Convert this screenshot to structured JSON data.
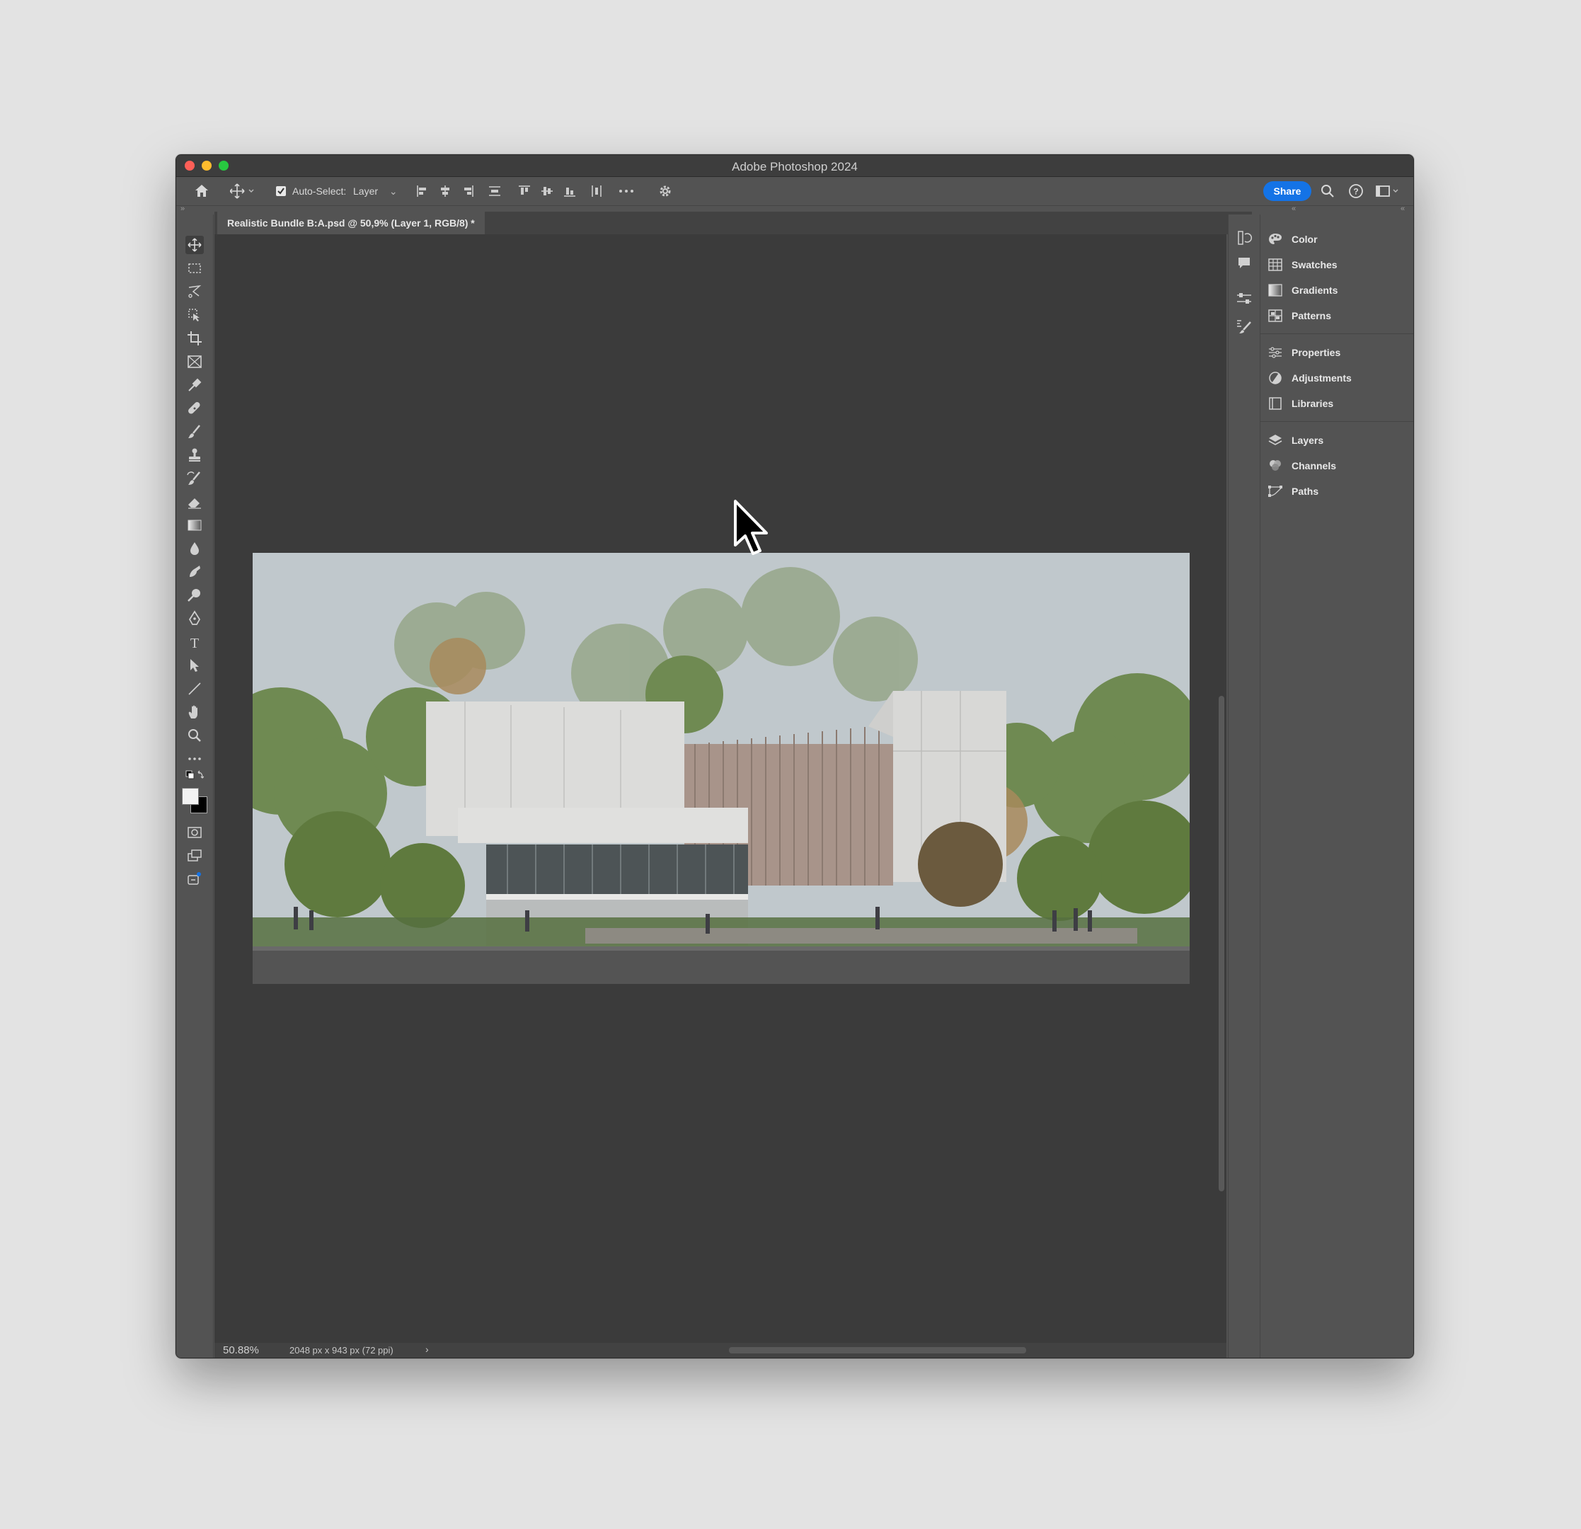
{
  "window": {
    "title": "Adobe Photoshop 2024"
  },
  "options_bar": {
    "auto_select_label": "Auto-Select:",
    "auto_select_checked": true,
    "auto_select_target": "Layer",
    "share_label": "Share"
  },
  "document": {
    "tab_title": "Realistic Bundle B:A.psd @ 50,9% (Layer 1, RGB/8) *"
  },
  "status": {
    "zoom": "50.88%",
    "doc_info": "2048 px x 943 px (72 ppi)"
  },
  "toolbar": {
    "tools": [
      "move-tool",
      "marquee-tool",
      "lasso-tool",
      "object-selection-tool",
      "crop-tool",
      "frame-tool",
      "eyedropper-tool",
      "healing-brush-tool",
      "brush-tool",
      "clone-stamp-tool",
      "history-brush-tool",
      "eraser-tool",
      "gradient-tool",
      "blur-tool",
      "smudge-tool",
      "dodge-tool",
      "pen-tool",
      "type-tool",
      "path-selection-tool",
      "line-tool",
      "hand-tool",
      "zoom-tool",
      "more-tools"
    ],
    "foreground_color": "#f2f2f2",
    "background_color": "#000000"
  },
  "panels": {
    "group1": [
      "Color",
      "Swatches",
      "Gradients",
      "Patterns"
    ],
    "group2": [
      "Properties",
      "Adjustments",
      "Libraries"
    ],
    "group3": [
      "Layers",
      "Channels",
      "Paths"
    ]
  },
  "colors": {
    "share_button": "#1473e6",
    "canvas_bg": "#3b3b3b",
    "ui_bg": "#535353"
  }
}
